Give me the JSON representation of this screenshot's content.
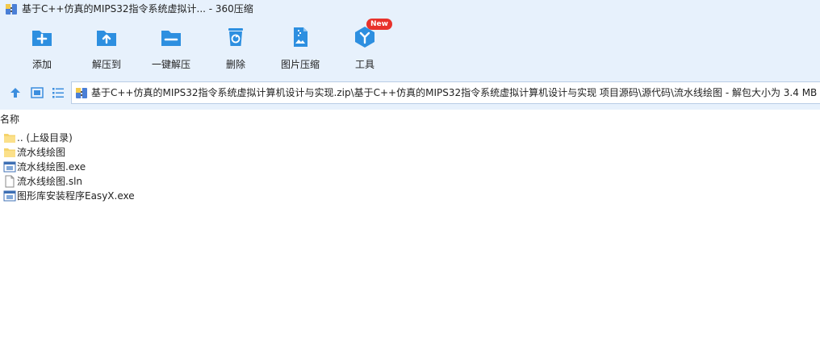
{
  "window": {
    "title": "基于C++仿真的MIPS32指令系统虚拟计... - 360压缩"
  },
  "toolbar": {
    "items": [
      {
        "label": "添加",
        "icon": "add-icon"
      },
      {
        "label": "解压到",
        "icon": "extract-to-icon"
      },
      {
        "label": "一键解压",
        "icon": "one-click-extract-icon"
      },
      {
        "label": "删除",
        "icon": "delete-icon"
      },
      {
        "label": "图片压缩",
        "icon": "image-compress-icon"
      },
      {
        "label": "工具",
        "icon": "tools-icon",
        "badge": "New"
      }
    ]
  },
  "address": {
    "path": "基于C++仿真的MIPS32指令系统虚拟计算机设计与实现.zip\\基于C++仿真的MIPS32指令系统虚拟计算机设计与实现 项目源码\\源代码\\流水线绘图 - 解包大小为 3.4 MB"
  },
  "list": {
    "column_name": "名称",
    "files": [
      {
        "name": ".. (上级目录)",
        "icon": "folder-up-icon"
      },
      {
        "name": "流水线绘图",
        "icon": "folder-icon"
      },
      {
        "name": "流水线绘图.exe",
        "icon": "exe-file-icon"
      },
      {
        "name": "流水线绘图.sln",
        "icon": "sln-file-icon"
      },
      {
        "name": "图形库安装程序EasyX.exe",
        "icon": "exe-file-icon"
      }
    ]
  },
  "colors": {
    "accent": "#2d8fe0",
    "toolbar_bg": "#e7f1fc",
    "badge": "#e8322b"
  }
}
